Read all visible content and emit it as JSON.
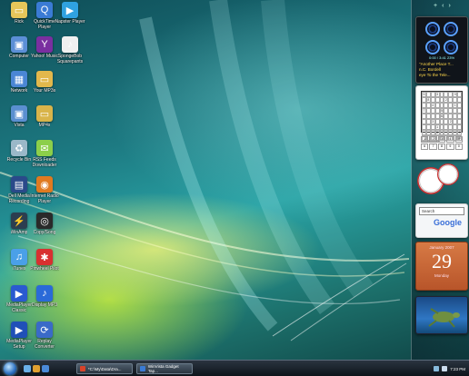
{
  "desktop": {
    "icons": [
      {
        "label": "Rick",
        "name": "rick-folder-icon",
        "color": "#e6c65a",
        "glyph": "▭"
      },
      {
        "label": "QuickTime Player",
        "name": "quicktime-icon",
        "color": "#3a7bd5",
        "glyph": "Q"
      },
      {
        "label": "Napster Player",
        "name": "napster-icon",
        "color": "#2fa2e0",
        "glyph": "▶"
      },
      {
        "label": "Computer",
        "name": "computer-icon",
        "color": "#5b8fd6",
        "glyph": "▣"
      },
      {
        "label": "Yahoo! Music",
        "name": "yahoo-music-icon",
        "color": "#7a2fa0",
        "glyph": "Y"
      },
      {
        "label": "SpongeBob Squarepants",
        "name": "spongebob-icon",
        "color": "#f0f0f0",
        "glyph": "♪"
      },
      {
        "label": "Network",
        "name": "network-icon",
        "color": "#4a86d4",
        "glyph": "▦"
      },
      {
        "label": "Your MP3s",
        "name": "mp3-folder-icon",
        "color": "#e2b84c",
        "glyph": "▭"
      },
      {
        "label": "Vista",
        "name": "vista-folder-icon",
        "color": "#5a8fd0",
        "glyph": "▣"
      },
      {
        "label": "MP4s",
        "name": "mp4-folder-icon",
        "color": "#d9b44a",
        "glyph": "▭"
      },
      {
        "label": "Recycle Bin",
        "name": "recycle-bin-icon",
        "color": "#9ab8c8",
        "glyph": "♻"
      },
      {
        "label": "RSS Feeds Downloader",
        "name": "rss-icon",
        "color": "#8ccf4a",
        "glyph": "✉"
      },
      {
        "label": "Dell Media Recording",
        "name": "media-recording-icon",
        "color": "#2a4a8a",
        "glyph": "▤"
      },
      {
        "label": "Internet Radio Player",
        "name": "radio-player-icon",
        "color": "#e07a20",
        "glyph": "◉"
      },
      {
        "label": "WinAmp",
        "name": "winamp-icon",
        "color": "#2c3e50",
        "glyph": "⚡"
      },
      {
        "label": "Copy/Song",
        "name": "copy-song-icon",
        "color": "#2a2a2a",
        "glyph": "◎"
      },
      {
        "label": "iTunes",
        "name": "itunes-icon",
        "color": "#4aa0e8",
        "glyph": "♫"
      },
      {
        "label": "Pinwheel Pilot",
        "name": "pinwheel-icon",
        "color": "#d83030",
        "glyph": "✱"
      },
      {
        "label": "MediaPlayer Classic",
        "name": "media-player-classic-icon",
        "color": "#2a5ad0",
        "glyph": "▶"
      },
      {
        "label": "Display MP3",
        "name": "display-mp3-icon",
        "color": "#2a6ad8",
        "glyph": "♪"
      },
      {
        "label": "MediaPlayer Setup",
        "name": "media-player-setup-icon",
        "color": "#2050b8",
        "glyph": "▶"
      },
      {
        "label": "Replay Converter",
        "name": "replay-converter-icon",
        "color": "#3a6ac8",
        "glyph": "⟳"
      }
    ]
  },
  "sidebar": {
    "controls": [
      "+",
      "‹",
      "›"
    ],
    "media": {
      "lines": [
        "\"Another Place T...",
        "n.C. Bordell",
        "eye To the Tele..."
      ],
      "time": "0:00 / 3:41  23%"
    },
    "sudoku": {
      "cells": [
        "5",
        "",
        "",
        "3",
        "",
        "",
        "",
        "9",
        "",
        "",
        "8",
        "",
        "",
        "",
        "2",
        "",
        "",
        "",
        "",
        "",
        "4",
        "",
        "",
        "",
        "",
        "1",
        "",
        "7",
        "",
        "",
        "",
        "5",
        "",
        "",
        "",
        "",
        "",
        "",
        "",
        "",
        "6",
        "",
        "",
        "",
        "",
        "",
        "",
        "3",
        "",
        "",
        "",
        "2",
        "",
        "",
        "",
        "",
        "",
        "1",
        "",
        "",
        "",
        "",
        "",
        "",
        "",
        "",
        "6",
        "",
        "",
        "",
        "",
        "4",
        "",
        "",
        "",
        "",
        "",
        "",
        "",
        "",
        "8",
        "",
        "",
        "",
        ""
      ],
      "numbers": [
        "1",
        "2",
        "3",
        "4",
        "5",
        "6",
        "7",
        "8",
        "9",
        "0"
      ]
    },
    "search": {
      "placeholder": "Search",
      "logo": "Google"
    },
    "calendar": {
      "month": "January 2007",
      "day": "29",
      "weekday": "Monday"
    }
  },
  "taskbar": {
    "tasks": [
      {
        "label": "*C:\\My\\Data\\Dra...",
        "color": "#d8432a"
      },
      {
        "label": "WinVista Gadget Tap...",
        "color": "#3a7bd5"
      }
    ],
    "clock": "7:23 PM"
  },
  "colors": {
    "accent": "#2b6fbf",
    "taskbar": "#1a222c"
  }
}
